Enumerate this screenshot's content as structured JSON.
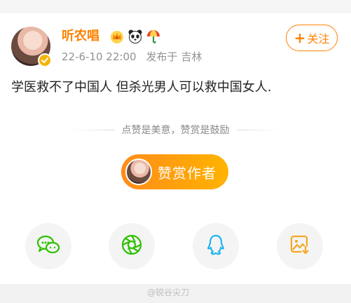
{
  "post": {
    "author": {
      "name": "听农唱"
    },
    "date": "22-6-10 22:00",
    "source": "发布于 吉林",
    "content": "学医救不了中国人 但杀光男人可以救中国女人."
  },
  "follow": {
    "plus": "+",
    "label": "关注"
  },
  "reward": {
    "hint": "点赞是美意，赞赏是鼓励",
    "button_label": "赞赏作者"
  },
  "share": {
    "icons": [
      "wechat-icon",
      "moments-icon",
      "qq-icon",
      "save-image-icon"
    ]
  },
  "colors": {
    "accent": "#ff8200",
    "verified": "#f5b400",
    "wechat": "#2dc100",
    "qq": "#1eb4f0",
    "save": "#f5a623"
  },
  "watermark": "@锐谷尖刀"
}
